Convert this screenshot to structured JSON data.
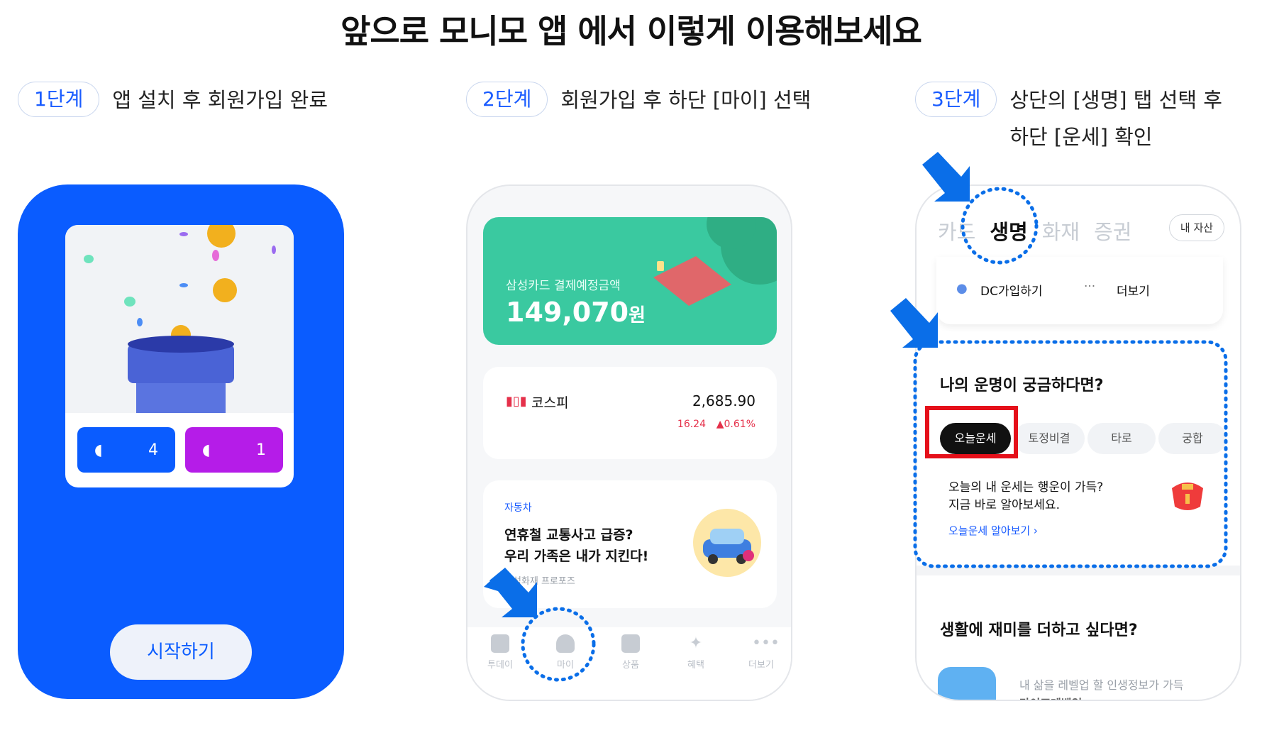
{
  "title": "앞으로 모니모 앱 에서 이렇게 이용해보세요",
  "steps": [
    {
      "badge": "1단계",
      "desc": "앱 설치 후 회원가입 완료"
    },
    {
      "badge": "2단계",
      "desc": "회원가입 후 하단 [마이] 선택"
    },
    {
      "badge": "3단계",
      "desc_line1": "상단의 [생명] 탭 선택 후",
      "desc_line2": "하단 [운세] 확인"
    }
  ],
  "phone1": {
    "blue_count": "4",
    "purple_count": "1",
    "start_label": "시작하기"
  },
  "phone2": {
    "card_label": "삼성카드 결제예정금액",
    "card_amount": "149,070",
    "card_unit": "원",
    "kospi_label": "코스피",
    "kospi_value": "2,685.90",
    "kospi_change": "16.24",
    "kospi_pct": "▲0.61%",
    "car_tag": "자동차",
    "car_line1": "연휴철 교통사고 급증?",
    "car_line2": "우리 가족은 내가 지킨다!",
    "car_sub": "삼성화재 프로포즈",
    "tabs": [
      "투데이",
      "마이",
      "상품",
      "혜택",
      "더보기"
    ]
  },
  "phone3": {
    "tabs": [
      "카드",
      "생명",
      "화재",
      "증권"
    ],
    "my_asset": "내 자산",
    "dc_label": "DC가입하기",
    "more_label": "더보기",
    "fortune_title": "나의 운명이 궁금하다면?",
    "chips": [
      "오늘운세",
      "토정비결",
      "타로",
      "궁합"
    ],
    "fortune_line1": "오늘의 내 운세는 행운이 가득?",
    "fortune_line2": "지금 바로 알아보세요.",
    "fortune_link": "오늘운세 알아보기 ›",
    "fun_title": "생활에 재미를 더하고 싶다면?",
    "fun_sub": "내 삶을 레벨업 할 인생정보가 가득",
    "fun_sub2": "라이프레벨업"
  },
  "colors": {
    "brand_blue": "#0a5cff",
    "purple": "#b51ce8",
    "green": "#3ac9a0",
    "highlight_red": "#e5101a",
    "arrow_blue": "#0a6ee8"
  }
}
